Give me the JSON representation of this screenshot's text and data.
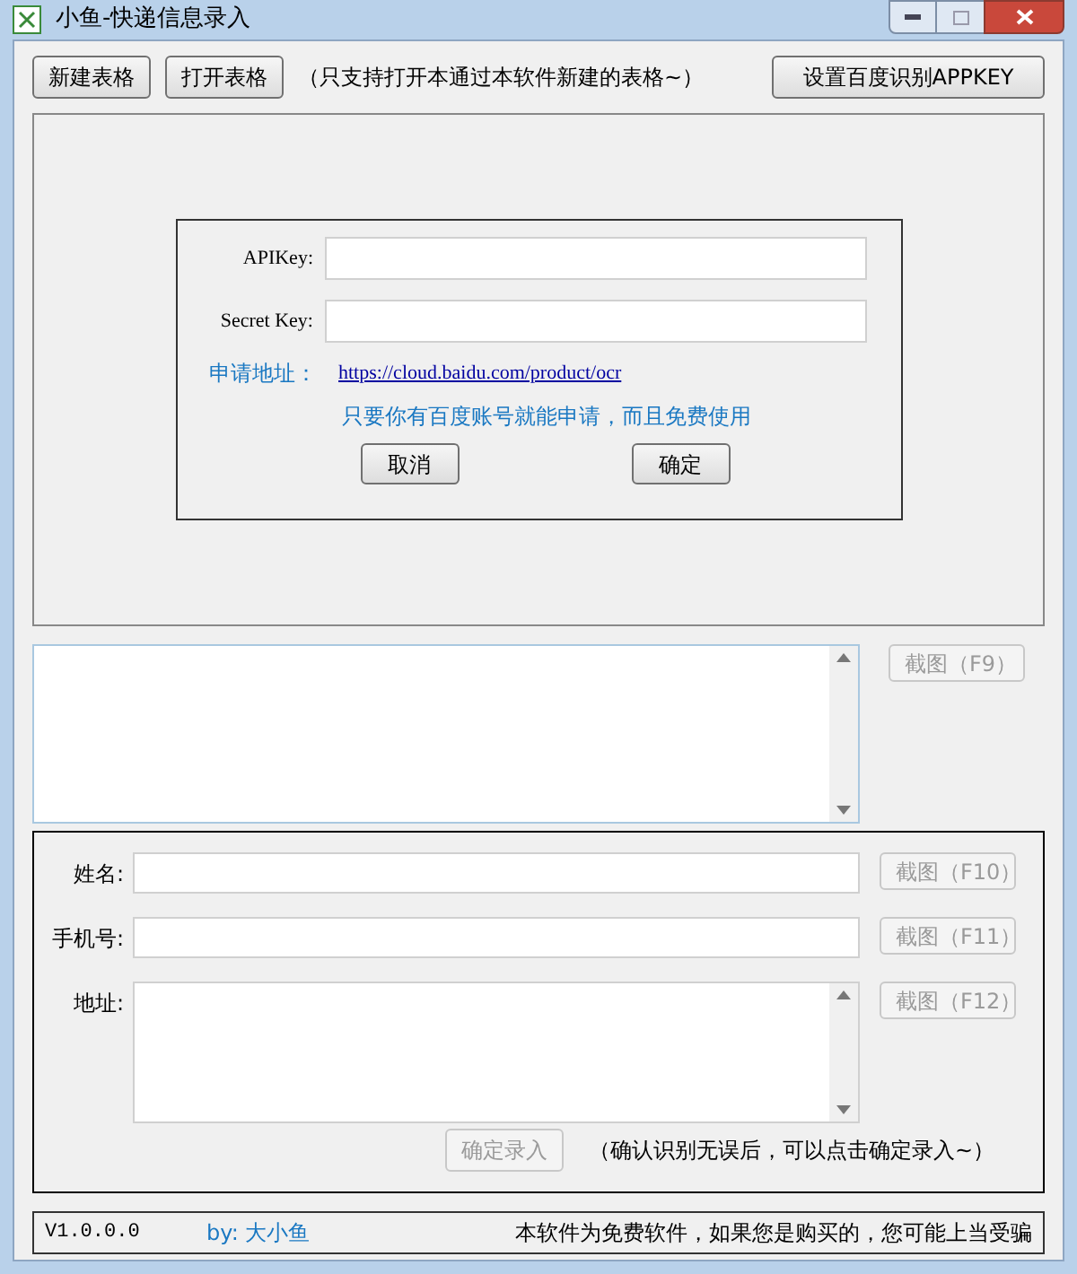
{
  "window": {
    "title": "小鱼-快递信息录入"
  },
  "toolbar": {
    "buttons": [
      "新建表格",
      "打开表格"
    ],
    "note": "（只支持打开本通过本软件新建的表格~）",
    "settings_button": "设置百度识别APPKEY"
  },
  "apikey_dialog": {
    "fields": [
      {
        "label": "APIKey:"
      },
      {
        "label": "Secret Key:"
      }
    ],
    "apply_label": "申请地址：",
    "apply_link": "https://cloud.baidu.com/product/ocr",
    "hint": "只要你有百度账号就能申请，而且免费使用",
    "buttons": [
      "取消",
      "确定"
    ]
  },
  "capture": {
    "button": {
      "label": "截图（F9）",
      "disabled": true
    }
  },
  "form": {
    "fields": [
      {
        "kind": "line",
        "label": "姓名:",
        "button": {
          "label": "截图（F10）",
          "disabled": true
        }
      },
      {
        "kind": "line",
        "label": "手机号:",
        "button": {
          "label": "截图（F11）",
          "disabled": true
        }
      },
      {
        "kind": "area",
        "label": "地址:",
        "button": {
          "label": "截图（F12）",
          "disabled": true
        }
      }
    ],
    "submit": {
      "label": "确定录入",
      "disabled": true
    },
    "note": "（确认识别无误后，可以点击确定录入~）"
  },
  "status_bar": {
    "version": "V1.0.0.0",
    "author_prefix": "by:",
    "author": "大小鱼",
    "notice": "本软件为免费软件，如果您是购买的，您可能上当受骗"
  }
}
